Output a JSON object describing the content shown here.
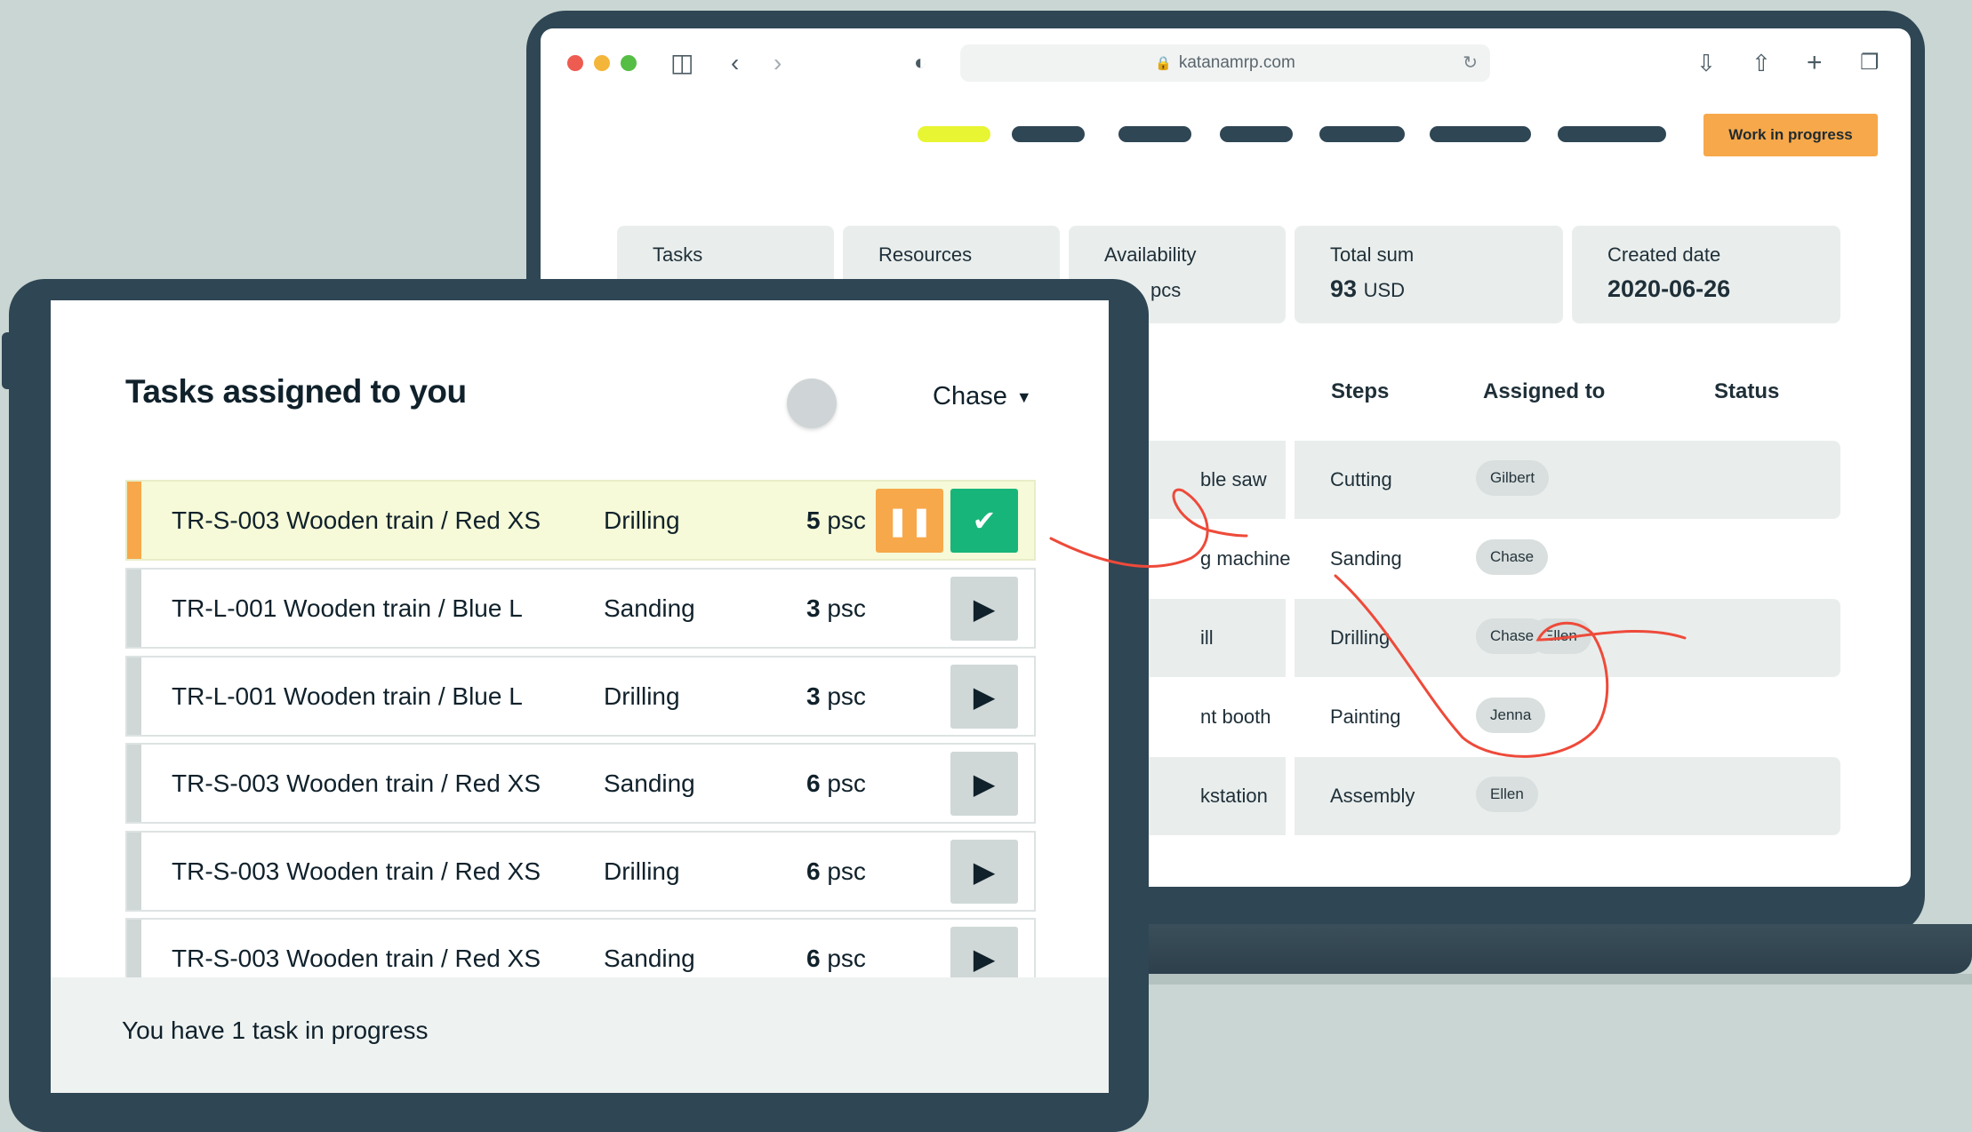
{
  "browser": {
    "url": "katanamrp.com",
    "icons": [
      "sidebar-icon",
      "back-icon",
      "forward-icon",
      "shield-icon",
      "download-icon",
      "share-icon",
      "new-tab-icon",
      "tabs-icon"
    ]
  },
  "header": {
    "work_in_progress_label": "Work in progress"
  },
  "summary": {
    "tasks_label": "Tasks",
    "resources_label": "Resources",
    "availability_label": "Availability",
    "availability_value": "pcs",
    "total_sum_label": "Total sum",
    "total_sum_value": "93",
    "total_sum_unit": "USD",
    "created_date_label": "Created date",
    "created_date_value": "2020-06-26"
  },
  "resource_table": {
    "headers": {
      "steps": "Steps",
      "assigned_to": "Assigned to",
      "status": "Status"
    },
    "rows": [
      {
        "resource": "ble saw",
        "step": "Cutting",
        "assignees": [
          "Gilbert"
        ],
        "status": "done"
      },
      {
        "resource": "g machine",
        "step": "Sanding",
        "assignees": [
          "Chase"
        ],
        "status": "done"
      },
      {
        "resource": "ill",
        "step": "Drilling",
        "assignees": [
          "Chase",
          "Ellen"
        ],
        "status": "in-progress"
      },
      {
        "resource": "nt booth",
        "step": "Painting",
        "assignees": [
          "Jenna"
        ],
        "status": "not-started"
      },
      {
        "resource": "kstation",
        "step": "Assembly",
        "assignees": [
          "Ellen"
        ],
        "status": "not-started"
      }
    ]
  },
  "tablet": {
    "title": "Tasks assigned to you",
    "user": "Chase",
    "tasks": [
      {
        "name": "TR-S-003 Wooden train / Red XS",
        "step": "Drilling",
        "qty": "5",
        "unit": "psc",
        "state": "active"
      },
      {
        "name": "TR-L-001 Wooden train / Blue L",
        "step": "Sanding",
        "qty": "3",
        "unit": "psc",
        "state": "idle"
      },
      {
        "name": "TR-L-001 Wooden train / Blue L",
        "step": "Drilling",
        "qty": "3",
        "unit": "psc",
        "state": "idle"
      },
      {
        "name": "TR-S-003 Wooden train / Red XS",
        "step": "Sanding",
        "qty": "6",
        "unit": "psc",
        "state": "idle"
      },
      {
        "name": "TR-S-003 Wooden train / Red XS",
        "step": "Drilling",
        "qty": "6",
        "unit": "psc",
        "state": "idle"
      },
      {
        "name": "TR-S-003 Wooden train / Red XS",
        "step": "Sanding",
        "qty": "6",
        "unit": "psc",
        "state": "idle"
      }
    ],
    "footer": "You have 1 task in progress"
  },
  "colors": {
    "frame": "#2f4654",
    "accent_yellow": "#e8f532",
    "accent_orange": "#f7a84a",
    "success_green": "#18b57a",
    "scribble_red": "#ee4a3a"
  }
}
